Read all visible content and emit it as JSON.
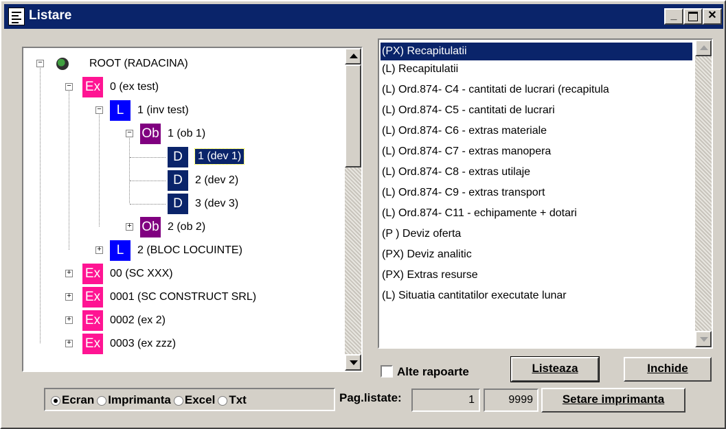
{
  "window": {
    "title": "Listare"
  },
  "tree": {
    "nodes": [
      {
        "badge": "",
        "label": "ROOT (RADACINA)",
        "color": ""
      },
      {
        "badge": "Ex",
        "label": "0 (ex test)",
        "color": "#ff1493"
      },
      {
        "badge": "L",
        "label": "1 (inv test)",
        "color": "#0000ff"
      },
      {
        "badge": "Ob",
        "label": "1 (ob 1)",
        "color": "#800080"
      },
      {
        "badge": "D",
        "label": "1 (dev 1)",
        "color": "#0a246a"
      },
      {
        "badge": "D",
        "label": "2 (dev 2)",
        "color": "#0a246a"
      },
      {
        "badge": "D",
        "label": "3 (dev 3)",
        "color": "#0a246a"
      },
      {
        "badge": "Ob",
        "label": "2 (ob 2)",
        "color": "#800080"
      },
      {
        "badge": "L",
        "label": "2 (BLOC LOCUINTE)",
        "color": "#0000ff"
      },
      {
        "badge": "Ex",
        "label": "00 (SC XXX)",
        "color": "#ff1493"
      },
      {
        "badge": "Ex",
        "label": "0001 (SC CONSTRUCT SRL)",
        "color": "#ff1493"
      },
      {
        "badge": "Ex",
        "label": "0002 (ex 2)",
        "color": "#ff1493"
      },
      {
        "badge": "Ex",
        "label": "0003 (ex zzz)",
        "color": "#ff1493"
      }
    ]
  },
  "reports": {
    "items": [
      "(PX) Recapitulatii",
      "(L) Recapitulatii",
      "(L) Ord.874- C4 - cantitati de lucrari (recapitula",
      "(L) Ord.874- C5 - cantitati de lucrari",
      "(L) Ord.874- C6 - extras materiale",
      "(L) Ord.874- C7 - extras manopera",
      "(L) Ord.874- C8 - extras utilaje",
      "(L) Ord.874- C9 - extras transport",
      "(L) Ord.874- C11 - echipamente + dotari",
      "(P ) Deviz oferta",
      "(PX) Deviz analitic",
      "(PX) Extras resurse",
      "(L) Situatia cantitatilor executate lunar"
    ],
    "selected_index": 0
  },
  "controls": {
    "alte_rapoarte": "Alte rapoarte",
    "listeaza": "Listeaza",
    "inchide": "Inchide",
    "output_options": [
      "Ecran",
      "Imprimanta",
      "Excel",
      "Txt"
    ],
    "output_selected": "Ecran",
    "pag_listate_label": "Pag.listate:",
    "page_from": "1",
    "page_to": "9999",
    "setare_imprimanta": "Setare imprimanta"
  },
  "colors": {
    "title_bar": "#0a246a",
    "ex": "#ff1493",
    "l": "#0000ff",
    "ob": "#800080",
    "d": "#0a246a"
  }
}
